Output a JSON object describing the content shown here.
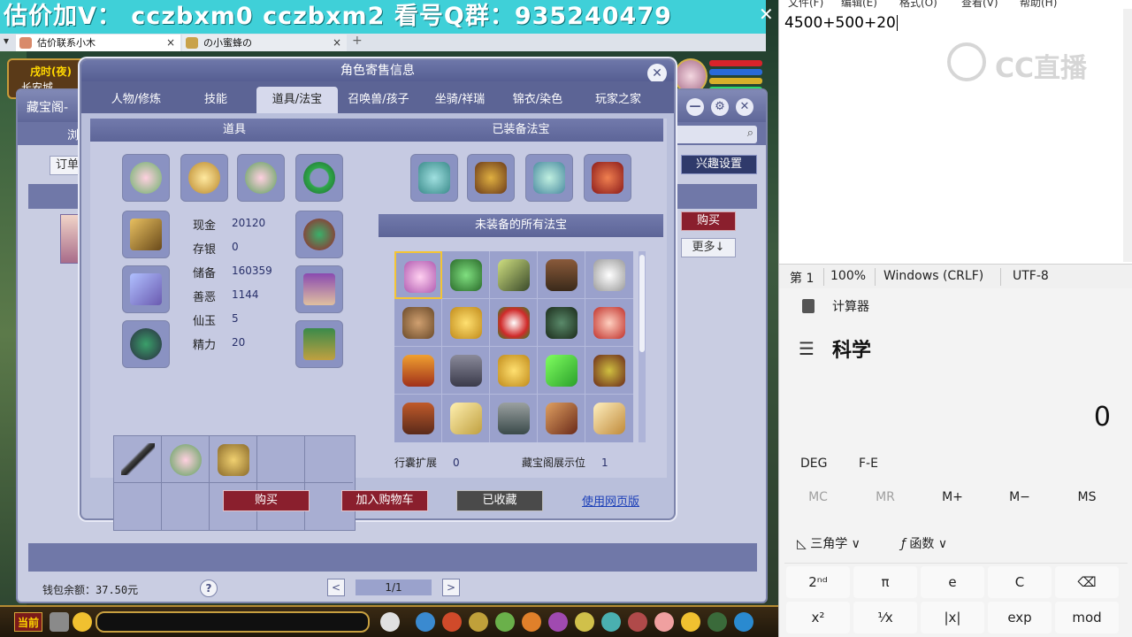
{
  "game": {
    "banner": "估价加V： cczbxm0  cczbxm2  看号Q群：935240479",
    "tabs": [
      {
        "label": "估价联系小木"
      },
      {
        "label": "の小蜜蜂の"
      }
    ],
    "status": {
      "time": "戌时(夜)",
      "location": "长安城"
    }
  },
  "back_window": {
    "title": "藏宝阁-",
    "nav_label": "浏",
    "order_label": "订单",
    "interest_button": "兴趣设置",
    "buy_button": "购买",
    "more_button": "更多↓",
    "wallet": "钱包余额：37.50元",
    "help": "?",
    "prev": "<",
    "next": ">",
    "page": "1/1"
  },
  "dialog": {
    "title": "角色寄售信息",
    "tabs": [
      "人物/修炼",
      "技能",
      "道具/法宝",
      "召唤兽/孩子",
      "坐骑/祥瑞",
      "锦衣/染色",
      "玩家之家"
    ],
    "active_tab": 2,
    "items_header": "道具",
    "equipped_header": "已装备法宝",
    "unequipped_header": "未装备的所有法宝",
    "stats": [
      {
        "label": "现金",
        "value": "20120"
      },
      {
        "label": "存银",
        "value": "0"
      },
      {
        "label": "储备",
        "value": "160359"
      },
      {
        "label": "善恶",
        "value": "1144"
      },
      {
        "label": "仙玉",
        "value": "5"
      },
      {
        "label": "精力",
        "value": "20"
      }
    ],
    "bag_expand_label": "行囊扩展",
    "bag_expand_value": "0",
    "display_slot_label": "藏宝阁展示位",
    "display_slot_value": "1",
    "buy_button": "购买",
    "cart_button": "加入购物车",
    "fav_button": "已收藏",
    "web_link": "使用网页版"
  },
  "bottom_bar": {
    "current_label": "当前"
  },
  "notepad": {
    "menu": [
      "文件(F)",
      "编辑(E)",
      "格式(O)",
      "查看(V)",
      "帮助(H)"
    ],
    "content": "4500+500+20",
    "watermark": "CC直播",
    "status": [
      "第 1",
      "100%",
      "Windows (CRLF)",
      "UTF-8"
    ]
  },
  "calculator": {
    "app_title": "计算器",
    "mode": "科学",
    "display": "0",
    "deg": "DEG",
    "fe": "F-E",
    "memory": [
      "MC",
      "MR",
      "M+",
      "M−",
      "MS"
    ],
    "trig": "三角学 ∨",
    "func": "函数 ∨",
    "keys_row1": [
      "2ⁿᵈ",
      "π",
      "e",
      "C",
      "⌫"
    ],
    "keys_row2": [
      "x²",
      "¹⁄x",
      "|x|",
      "exp",
      "mod"
    ]
  }
}
